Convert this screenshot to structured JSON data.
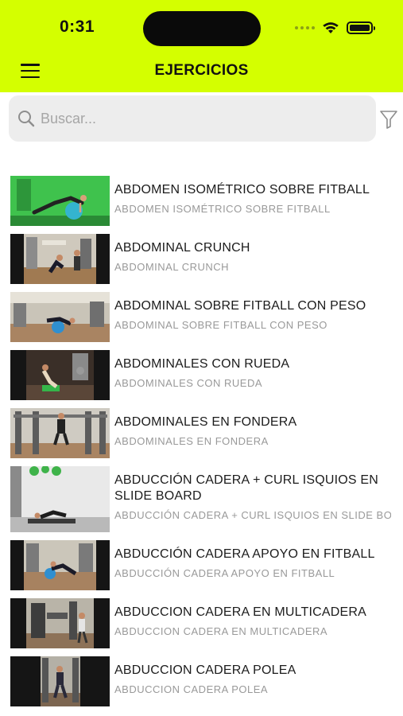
{
  "status_bar": {
    "time": "0:31"
  },
  "header": {
    "title": "EJERCICIOS",
    "menu_icon": "hamburger-menu-icon"
  },
  "search": {
    "placeholder": "Buscar...",
    "value": "",
    "icon": "search-icon",
    "filter_icon": "filter-icon"
  },
  "exercises": [
    {
      "title": "ABDOMEN ISOMÉTRICO SOBRE FITBALL",
      "subtitle": "ABDOMEN ISOMÉTRICO SOBRE FITBALL"
    },
    {
      "title": "ABDOMINAL CRUNCH",
      "subtitle": "ABDOMINAL CRUNCH"
    },
    {
      "title": "ABDOMINAL SOBRE FITBALL CON PESO",
      "subtitle": "ABDOMINAL SOBRE FITBALL CON PESO"
    },
    {
      "title": "ABDOMINALES CON RUEDA",
      "subtitle": "ABDOMINALES CON RUEDA"
    },
    {
      "title": "ABDOMINALES EN FONDERA",
      "subtitle": "ABDOMINALES EN FONDERA"
    },
    {
      "title": "ABDUCCIÓN CADERA + CURL ISQUIOS EN SLIDE BOARD",
      "subtitle": "ABDUCCIÓN CADERA + CURL ISQUIOS EN SLIDE BOARD"
    },
    {
      "title": "ABDUCCIÓN CADERA APOYO EN FITBALL",
      "subtitle": "ABDUCCIÓN CADERA APOYO EN FITBALL"
    },
    {
      "title": "ABDUCCION CADERA EN MULTICADERA",
      "subtitle": "ABDUCCION CADERA EN MULTICADERA"
    },
    {
      "title": "ABDUCCION CADERA POLEA",
      "subtitle": "ABDUCCION CADERA POLEA"
    }
  ]
}
